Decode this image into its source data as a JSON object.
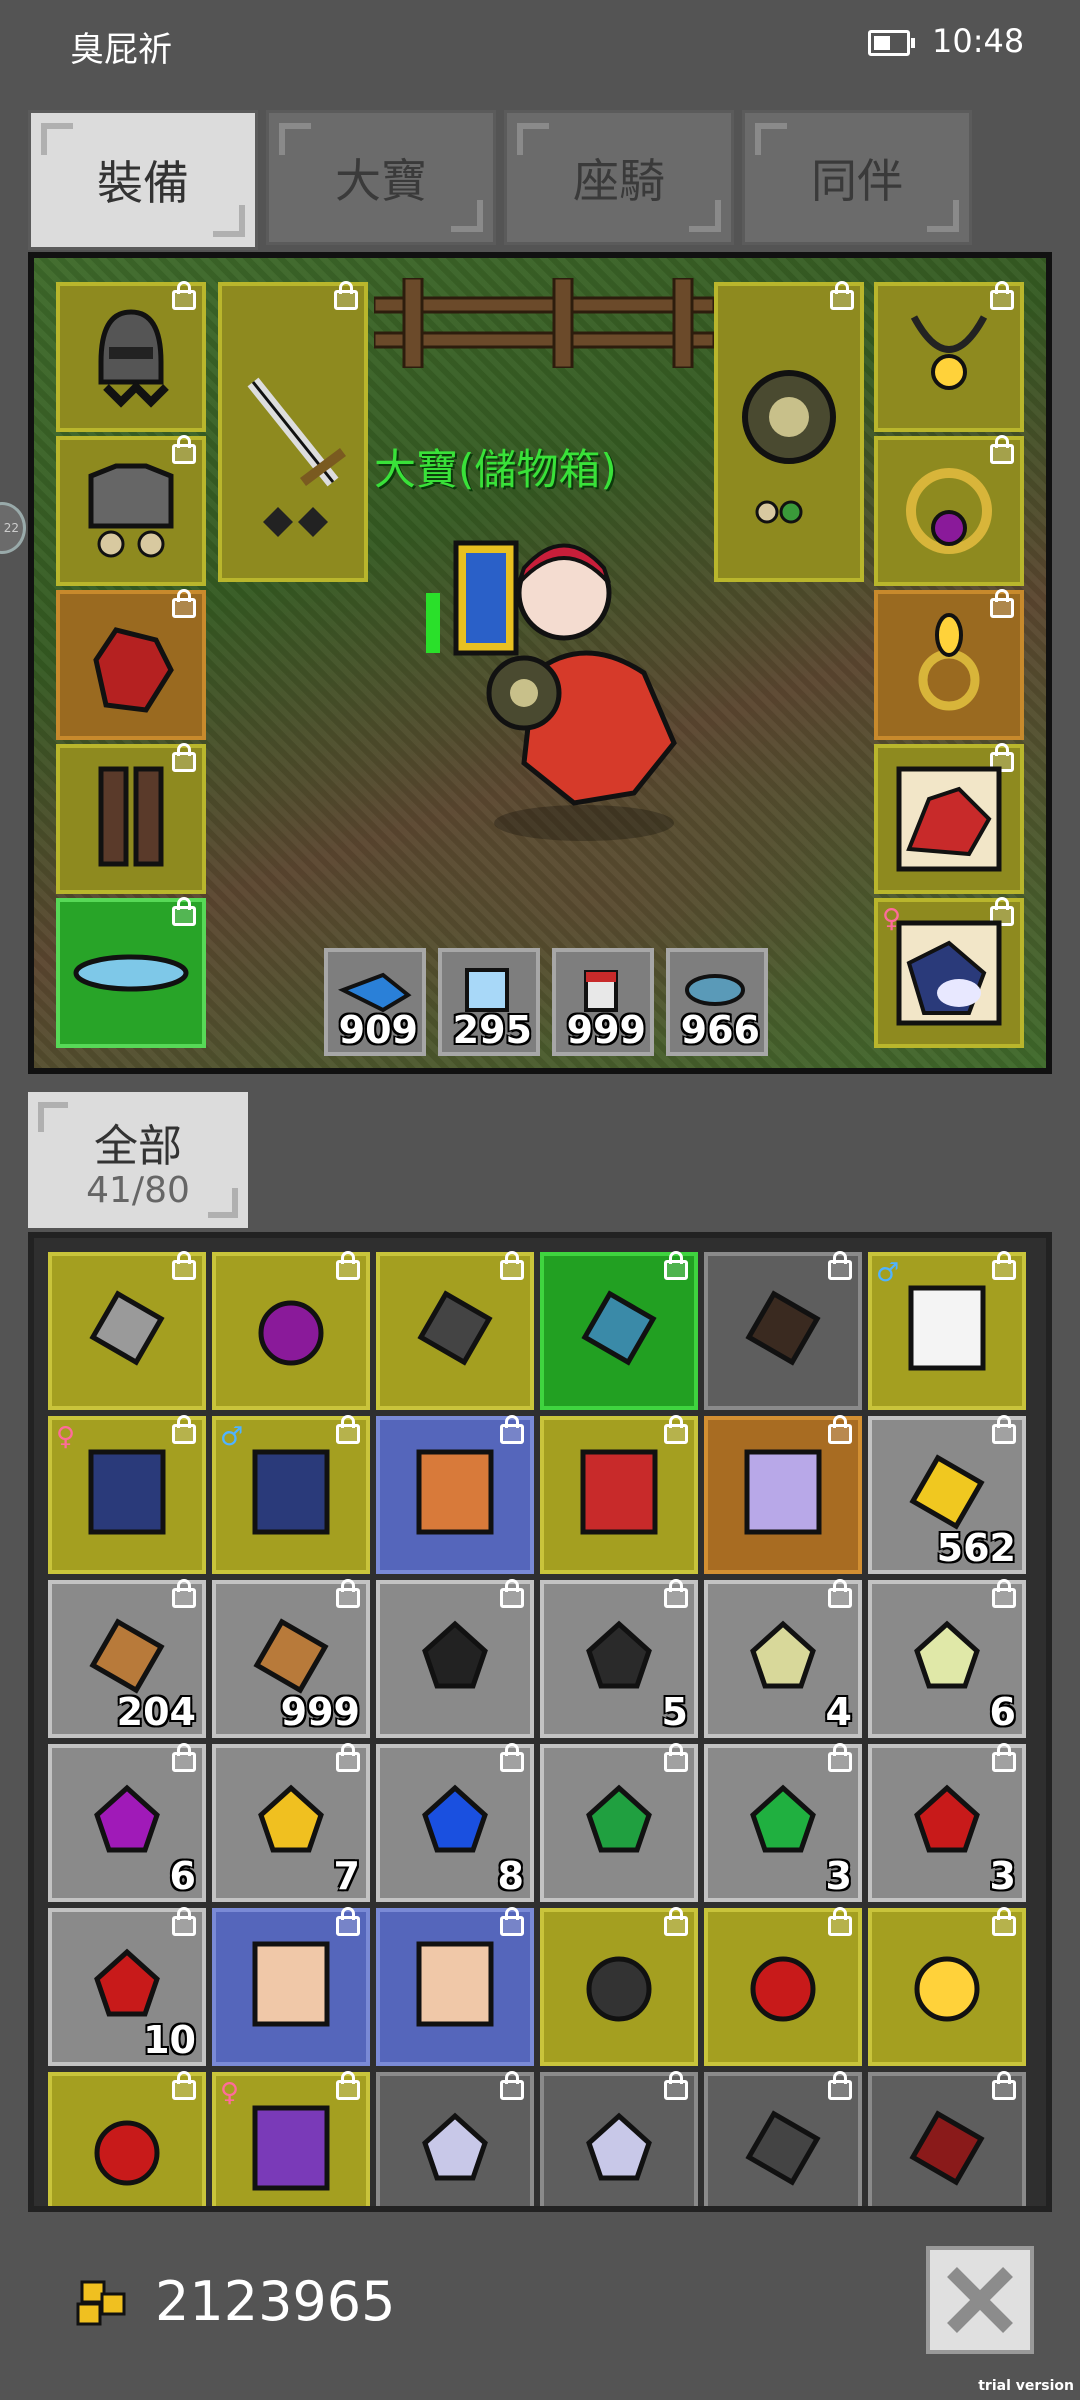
{
  "status_bar": {
    "player_name": "臭屁祈",
    "time": "10:48"
  },
  "tabs": [
    {
      "label": "裝備",
      "active": true
    },
    {
      "label": "大寶",
      "active": false
    },
    {
      "label": "座騎",
      "active": false
    },
    {
      "label": "同伴",
      "active": false
    }
  ],
  "scene": {
    "pet_label": "大寶(儲物箱)",
    "left_slots": [
      "helmet-icon",
      "armor-icon",
      "gloves-icon",
      "boots-icon",
      "belt-icon"
    ],
    "weapon_slot": "sword-icon",
    "shield_slot": "shield-icon",
    "right_slots": [
      "necklace-icon",
      "ring-icon",
      "earring-icon",
      "mount-card-icon",
      "bird-card-icon"
    ],
    "consumables": [
      {
        "icon": "blue-potion-icon",
        "count": "909"
      },
      {
        "icon": "scroll-icon",
        "count": "295"
      },
      {
        "icon": "red-potion-icon",
        "count": "999"
      },
      {
        "icon": "fish-icon",
        "count": "966"
      }
    ]
  },
  "inventory_filter": {
    "label": "全部",
    "count": "41/80"
  },
  "inventory": [
    {
      "icon": "axe-icon",
      "rarity": "gold",
      "qty": ""
    },
    {
      "icon": "purple-ring-icon",
      "rarity": "gold",
      "qty": ""
    },
    {
      "icon": "spear-icon",
      "rarity": "gold",
      "qty": ""
    },
    {
      "icon": "chainmail-icon",
      "rarity": "green",
      "qty": ""
    },
    {
      "icon": "horned-helmet-icon",
      "rarity": "dgray",
      "qty": ""
    },
    {
      "icon": "snowman-card-icon",
      "rarity": "gold",
      "qty": ""
    },
    {
      "icon": "bird-card-icon",
      "rarity": "gold",
      "qty": ""
    },
    {
      "icon": "bird-card-icon",
      "rarity": "gold",
      "qty": ""
    },
    {
      "icon": "orange-card-icon",
      "rarity": "blue",
      "qty": ""
    },
    {
      "icon": "rooster-card-icon",
      "rarity": "gold",
      "qty": ""
    },
    {
      "icon": "unicorn-card-icon",
      "rarity": "orange",
      "qty": ""
    },
    {
      "icon": "cheese-icon",
      "rarity": "gray",
      "qty": "562"
    },
    {
      "icon": "bread-icon",
      "rarity": "gray",
      "qty": "204"
    },
    {
      "icon": "bread-icon",
      "rarity": "gray",
      "qty": "999"
    },
    {
      "icon": "coal-icon",
      "rarity": "gray",
      "qty": ""
    },
    {
      "icon": "black-gem-icon",
      "rarity": "gray",
      "qty": "5"
    },
    {
      "icon": "pale-ore-icon",
      "rarity": "gray",
      "qty": "4"
    },
    {
      "icon": "pale-gem-icon",
      "rarity": "gray",
      "qty": "6"
    },
    {
      "icon": "purple-gem-icon",
      "rarity": "gray",
      "qty": "6"
    },
    {
      "icon": "yellow-gem-icon",
      "rarity": "gray",
      "qty": "7"
    },
    {
      "icon": "blue-gem-icon",
      "rarity": "gray",
      "qty": "8"
    },
    {
      "icon": "green-ore-icon",
      "rarity": "gray",
      "qty": ""
    },
    {
      "icon": "green-gem-icon",
      "rarity": "gray",
      "qty": "3"
    },
    {
      "icon": "red-ore-icon",
      "rarity": "gray",
      "qty": "3"
    },
    {
      "icon": "red-gem-icon",
      "rarity": "gray",
      "qty": "10"
    },
    {
      "icon": "card-pack-icon",
      "rarity": "blue",
      "qty": ""
    },
    {
      "icon": "card-pack-icon",
      "rarity": "blue",
      "qty": ""
    },
    {
      "icon": "black-ring-icon",
      "rarity": "gold",
      "qty": ""
    },
    {
      "icon": "red-ring-icon",
      "rarity": "gold",
      "qty": ""
    },
    {
      "icon": "earring-icon",
      "rarity": "gold",
      "qty": ""
    },
    {
      "icon": "amulet-icon",
      "rarity": "gold",
      "qty": ""
    },
    {
      "icon": "mage-card-icon",
      "rarity": "gold",
      "qty": ""
    },
    {
      "icon": "gem-dagger-icon",
      "rarity": "dgray",
      "qty": ""
    },
    {
      "icon": "gem-dagger-icon",
      "rarity": "dgray",
      "qty": ""
    },
    {
      "icon": "scythe-icon",
      "rarity": "dgray",
      "qty": ""
    },
    {
      "icon": "red-scythe-icon",
      "rarity": "dgray",
      "qty": ""
    }
  ],
  "gold": {
    "amount": "2123965"
  },
  "watermark": "trial version",
  "side_bubble": "22"
}
